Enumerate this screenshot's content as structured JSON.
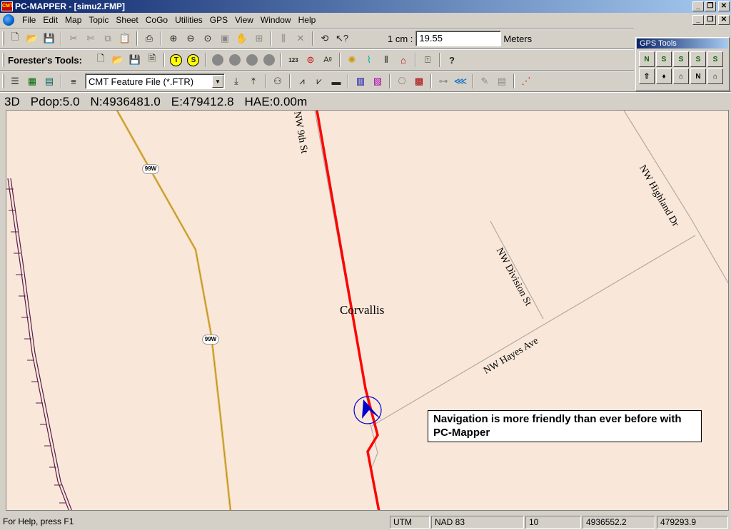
{
  "window": {
    "title": "PC-MAPPER - [simu2.FMP]",
    "app_icon_text": "CMT",
    "btn_minimize": "_",
    "btn_restore": "❐",
    "btn_close": "✕"
  },
  "menu": [
    {
      "label": "File"
    },
    {
      "label": "Edit"
    },
    {
      "label": "Map"
    },
    {
      "label": "Topic"
    },
    {
      "label": "Sheet"
    },
    {
      "label": "CoGo"
    },
    {
      "label": "Utilities"
    },
    {
      "label": "GPS"
    },
    {
      "label": "View"
    },
    {
      "label": "Window"
    },
    {
      "label": "Help"
    }
  ],
  "toolbar1": {
    "scale_label": "1 cm :",
    "scale_value": "19.55",
    "scale_unit": "Meters",
    "icons": [
      "new-icon",
      "open-icon",
      "save-icon",
      "cut-icon",
      "scissors-icon",
      "copy-icon",
      "paste-icon",
      "print-icon",
      "zoom-in-icon",
      "zoom-out-icon",
      "zoom-full-icon",
      "zoom-window-icon",
      "pan-icon",
      "extent-icon",
      "split-icon",
      "delete-vertex-icon",
      "navigate-icon",
      "help-pointer-icon"
    ]
  },
  "toolbar2": {
    "label": "Forester's Tools:",
    "round_t": "T",
    "round_s": "S",
    "num_icon": "123"
  },
  "toolbar3": {
    "feature_file": "CMT Feature File (*.FTR)"
  },
  "gps_tools": {
    "title": "GPS Tools",
    "buttons": [
      "N",
      "S",
      "S",
      "S",
      "S",
      "⇧",
      "♦",
      "⌂",
      "N",
      "⌂"
    ]
  },
  "gps_status": {
    "fix": "3D",
    "pdop": "Pdop:5.0",
    "northing": "N:4936481.0",
    "easting": "E:479412.8",
    "hae": "HAE:0.00m"
  },
  "map": {
    "labels": {
      "nw9th": "NW 9th St",
      "highland": "NW Highland Dr",
      "division": "NW Division St",
      "hayes": "NW Hayes Ave",
      "city": "Corvallis",
      "hwy1": "99W",
      "hwy2": "99W"
    },
    "callout": "Navigation is more friendly than ever before with PC-Mapper",
    "colors": {
      "background": "#f9e8da",
      "route": "#ff0000",
      "highway": "#e0b850",
      "railway": "#5a1a4a",
      "street": "#b0aaa4",
      "cursor": "#0000cc"
    }
  },
  "statusbar": {
    "help": "For Help, press F1",
    "projection": "UTM",
    "datum": "NAD 83",
    "zone": "10",
    "north": "4936552.2",
    "east": "479293.9"
  }
}
